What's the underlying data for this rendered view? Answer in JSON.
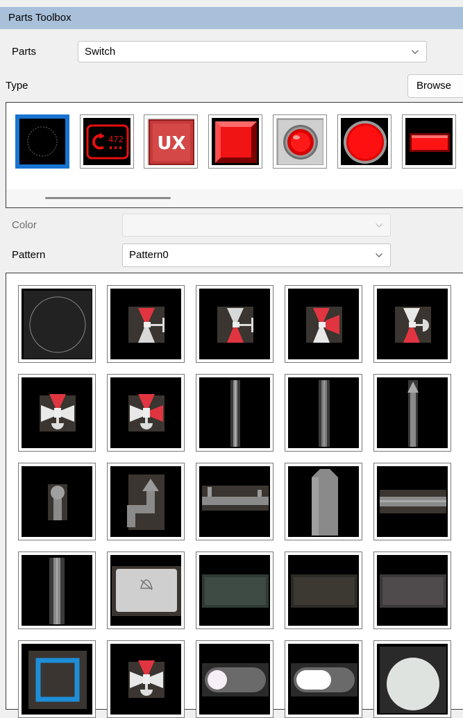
{
  "toolbox": {
    "title": "Parts Toolbox"
  },
  "parts": {
    "label": "Parts",
    "value": "Switch"
  },
  "type": {
    "label": "Type",
    "browse_label": "Browse"
  },
  "type_parts": [
    {
      "name": "circle-outline-part-icon"
    },
    {
      "name": "digital-counter-part-icon",
      "text": "472"
    },
    {
      "name": "ux-button-part-icon",
      "text": "UX"
    },
    {
      "name": "red-square-button-part-icon"
    },
    {
      "name": "red-lamp-button-part-icon"
    },
    {
      "name": "red-round-button-part-icon"
    },
    {
      "name": "red-rect-button-part-icon"
    }
  ],
  "color": {
    "label": "Color",
    "value": ""
  },
  "pattern": {
    "label": "Pattern",
    "value": "Pattern0"
  },
  "patterns": [
    "circle-pattern-icon",
    "valve-t-pattern-icon",
    "valve-t-pattern-icon",
    "valve-side-pattern-icon",
    "valve-knob-pattern-icon",
    "valve-down-pattern-icon",
    "valve-down-pattern-icon",
    "pipe-vertical-pattern-icon",
    "pipe-vertical-pattern-icon",
    "pipe-arrow-up-pattern-icon",
    "pipe-end-pattern-icon",
    "pipe-elbow-arrow-pattern-icon",
    "pipe-horizontal-bracket-pattern-icon",
    "tank-pattern-icon",
    "pipe-horizontal-pattern-icon",
    "pipe-vertical-pattern-icon",
    "bell-mute-button-pattern-icon",
    "green-rect-pattern-icon",
    "olive-rect-pattern-icon",
    "gray-rect-pattern-icon",
    "blue-square-frame-pattern-icon",
    "valve-down-pattern-icon",
    "toggle-off-pattern-icon",
    "toggle-on-pattern-icon",
    "white-circle-pattern-icon"
  ],
  "colors": {
    "title_bg": "#a9c0da",
    "selection": "#1874d0",
    "accent_red": "#e80f0f"
  }
}
